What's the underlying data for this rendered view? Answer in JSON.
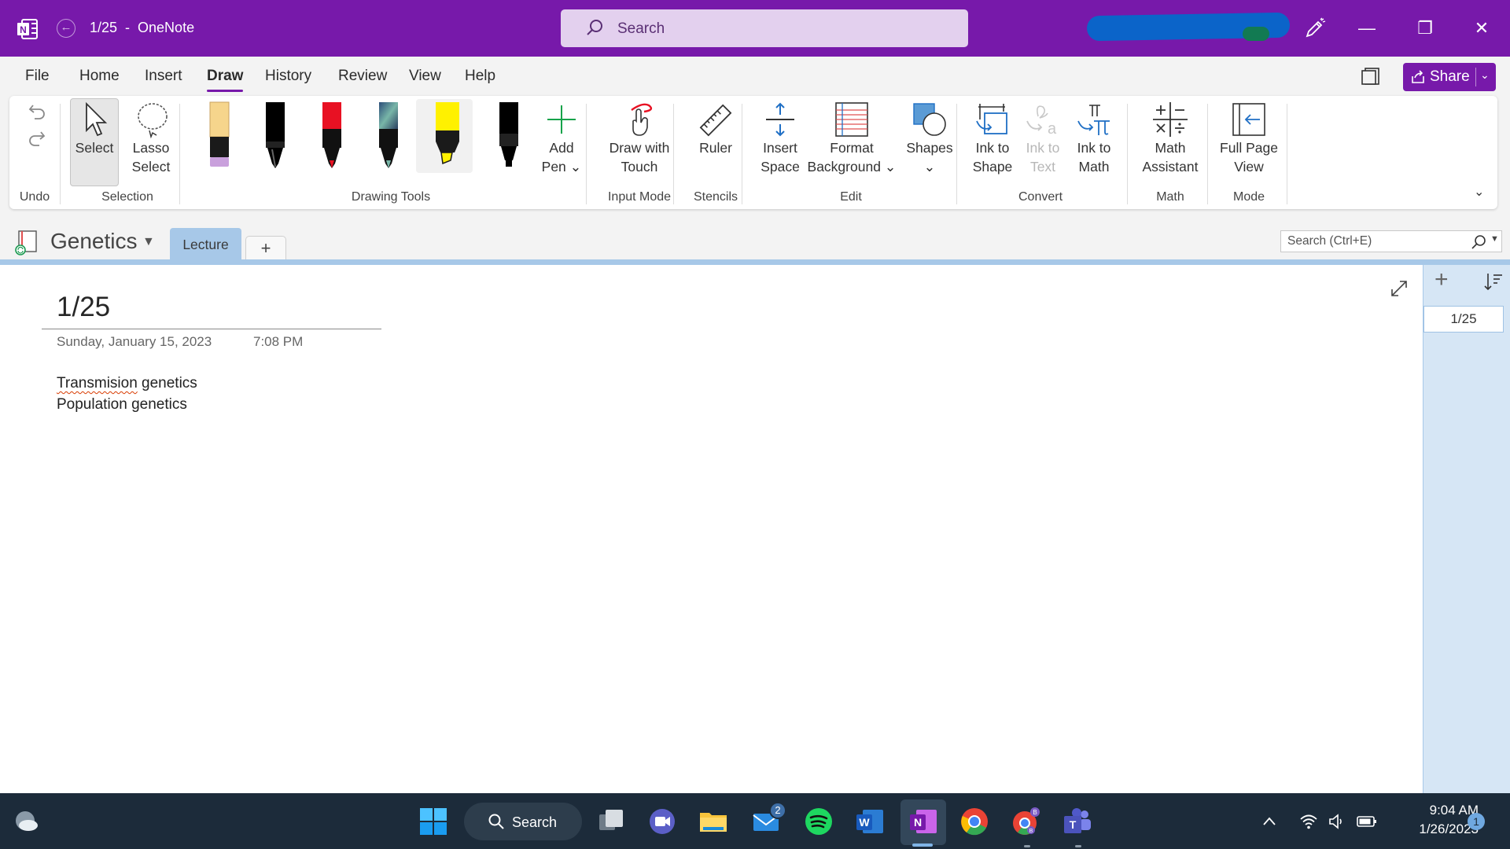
{
  "titlebar": {
    "title": "1/25  -  OneNote",
    "search_placeholder": "Search"
  },
  "menu": {
    "tabs": [
      {
        "label": "File"
      },
      {
        "label": "Home"
      },
      {
        "label": "Insert"
      },
      {
        "label": "Draw",
        "active": true
      },
      {
        "label": "History"
      },
      {
        "label": "Review"
      },
      {
        "label": "View"
      },
      {
        "label": "Help"
      }
    ],
    "share_label": "Share"
  },
  "ribbon": {
    "groups": {
      "undo": "Undo",
      "selection": "Selection",
      "drawing_tools": "Drawing Tools",
      "input_mode": "Input Mode",
      "stencils": "Stencils",
      "edit": "Edit",
      "convert": "Convert",
      "math": "Math",
      "mode": "Mode"
    },
    "select": [
      "Select"
    ],
    "lasso": [
      "Lasso",
      "Select"
    ],
    "add_pen": [
      "Add",
      "Pen ⌄"
    ],
    "draw_touch": [
      "Draw with",
      "Touch"
    ],
    "ruler": [
      "Ruler"
    ],
    "insert_space": [
      "Insert",
      "Space"
    ],
    "format_background": [
      "Format",
      "Background ⌄"
    ],
    "shapes": [
      "Shapes",
      "⌄"
    ],
    "ink_to_shape": [
      "Ink to",
      "Shape"
    ],
    "ink_to_text": [
      "Ink to",
      "Text"
    ],
    "ink_to_math": [
      "Ink to",
      "Math"
    ],
    "math_assistant": [
      "Math",
      "Assistant"
    ],
    "full_page_view": [
      "Full Page",
      "View"
    ],
    "pens": [
      {
        "name": "pale-yellow-highlighter",
        "color": "#f6d58c",
        "tip": "#c9a0dc"
      },
      {
        "name": "black-pen",
        "color": "#000000",
        "tip": "#000000"
      },
      {
        "name": "red-pen",
        "color": "#e81123",
        "tip": "#e81123"
      },
      {
        "name": "galaxy-pen",
        "color": "#3a6f7f",
        "tip": "#78b6a8"
      },
      {
        "name": "yellow-highlighter",
        "color": "#fff100",
        "tip": "#fff100"
      },
      {
        "name": "black-marker",
        "color": "#000000",
        "tip": "#000000"
      }
    ],
    "accent": "#7719aa"
  },
  "notebook": {
    "name": "Genetics",
    "section_tab": "Lecture",
    "add_section": "+",
    "search_placeholder": "Search (Ctrl+E)"
  },
  "page": {
    "title": "1/25",
    "date": "Sunday, January 15, 2023",
    "time": "7:08 PM",
    "line1_misspelled": "Transmision",
    "line1_rest": " genetics",
    "line2": "Population genetics"
  },
  "pagelist": {
    "pages": [
      "1/25"
    ]
  },
  "taskbar": {
    "search_label": "Search",
    "mail_badge": "2",
    "time": "9:04 AM",
    "date": "1/26/2023",
    "notifications": "1"
  }
}
